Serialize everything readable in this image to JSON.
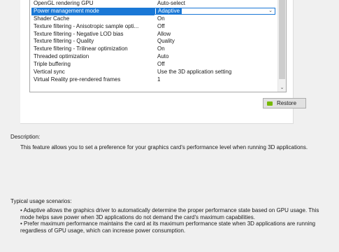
{
  "settings": {
    "rows": [
      {
        "feature": "OpenGL rendering GPU",
        "value": "Auto-select"
      },
      {
        "feature": "Power management mode",
        "value": "Adaptive",
        "selected": true
      },
      {
        "feature": "Shader Cache",
        "value": "On"
      },
      {
        "feature": "Texture filtering - Anisotropic sample opti...",
        "value": "Off"
      },
      {
        "feature": "Texture filtering - Negative LOD bias",
        "value": "Allow"
      },
      {
        "feature": "Texture filtering - Quality",
        "value": "Quality"
      },
      {
        "feature": "Texture filtering - Trilinear optimization",
        "value": "On"
      },
      {
        "feature": "Threaded optimization",
        "value": "Auto"
      },
      {
        "feature": "Triple buffering",
        "value": "Off"
      },
      {
        "feature": "Vertical sync",
        "value": "Use the 3D application setting"
      },
      {
        "feature": "Virtual Reality pre-rendered frames",
        "value": "1"
      }
    ],
    "dropdown_arrow": "chevron-down-icon",
    "scroll_down_arrow": "chevron-down-icon"
  },
  "restore": {
    "label": "Restore",
    "icon": "nvidia-icon",
    "icon_color": "#76b900"
  },
  "description": {
    "label": "Description:",
    "text": "This feature allows you to set a preference for your graphics card's performance level when running 3D applications."
  },
  "usage": {
    "label": "Typical usage scenarios:",
    "items": [
      "• Adaptive allows the graphics driver to automatically determine the proper performance state based on GPU usage. This mode helps save power when 3D applications do not demand the card's maximum capabilities.",
      "• Prefer maximum performance maintains the card at its maximum performance state when 3D applications are running regardless of GPU usage, which can increase power consumption."
    ]
  },
  "colors": {
    "selection": "#1a78d6",
    "background": "#f0f0f0",
    "panel": "#ffffff"
  }
}
